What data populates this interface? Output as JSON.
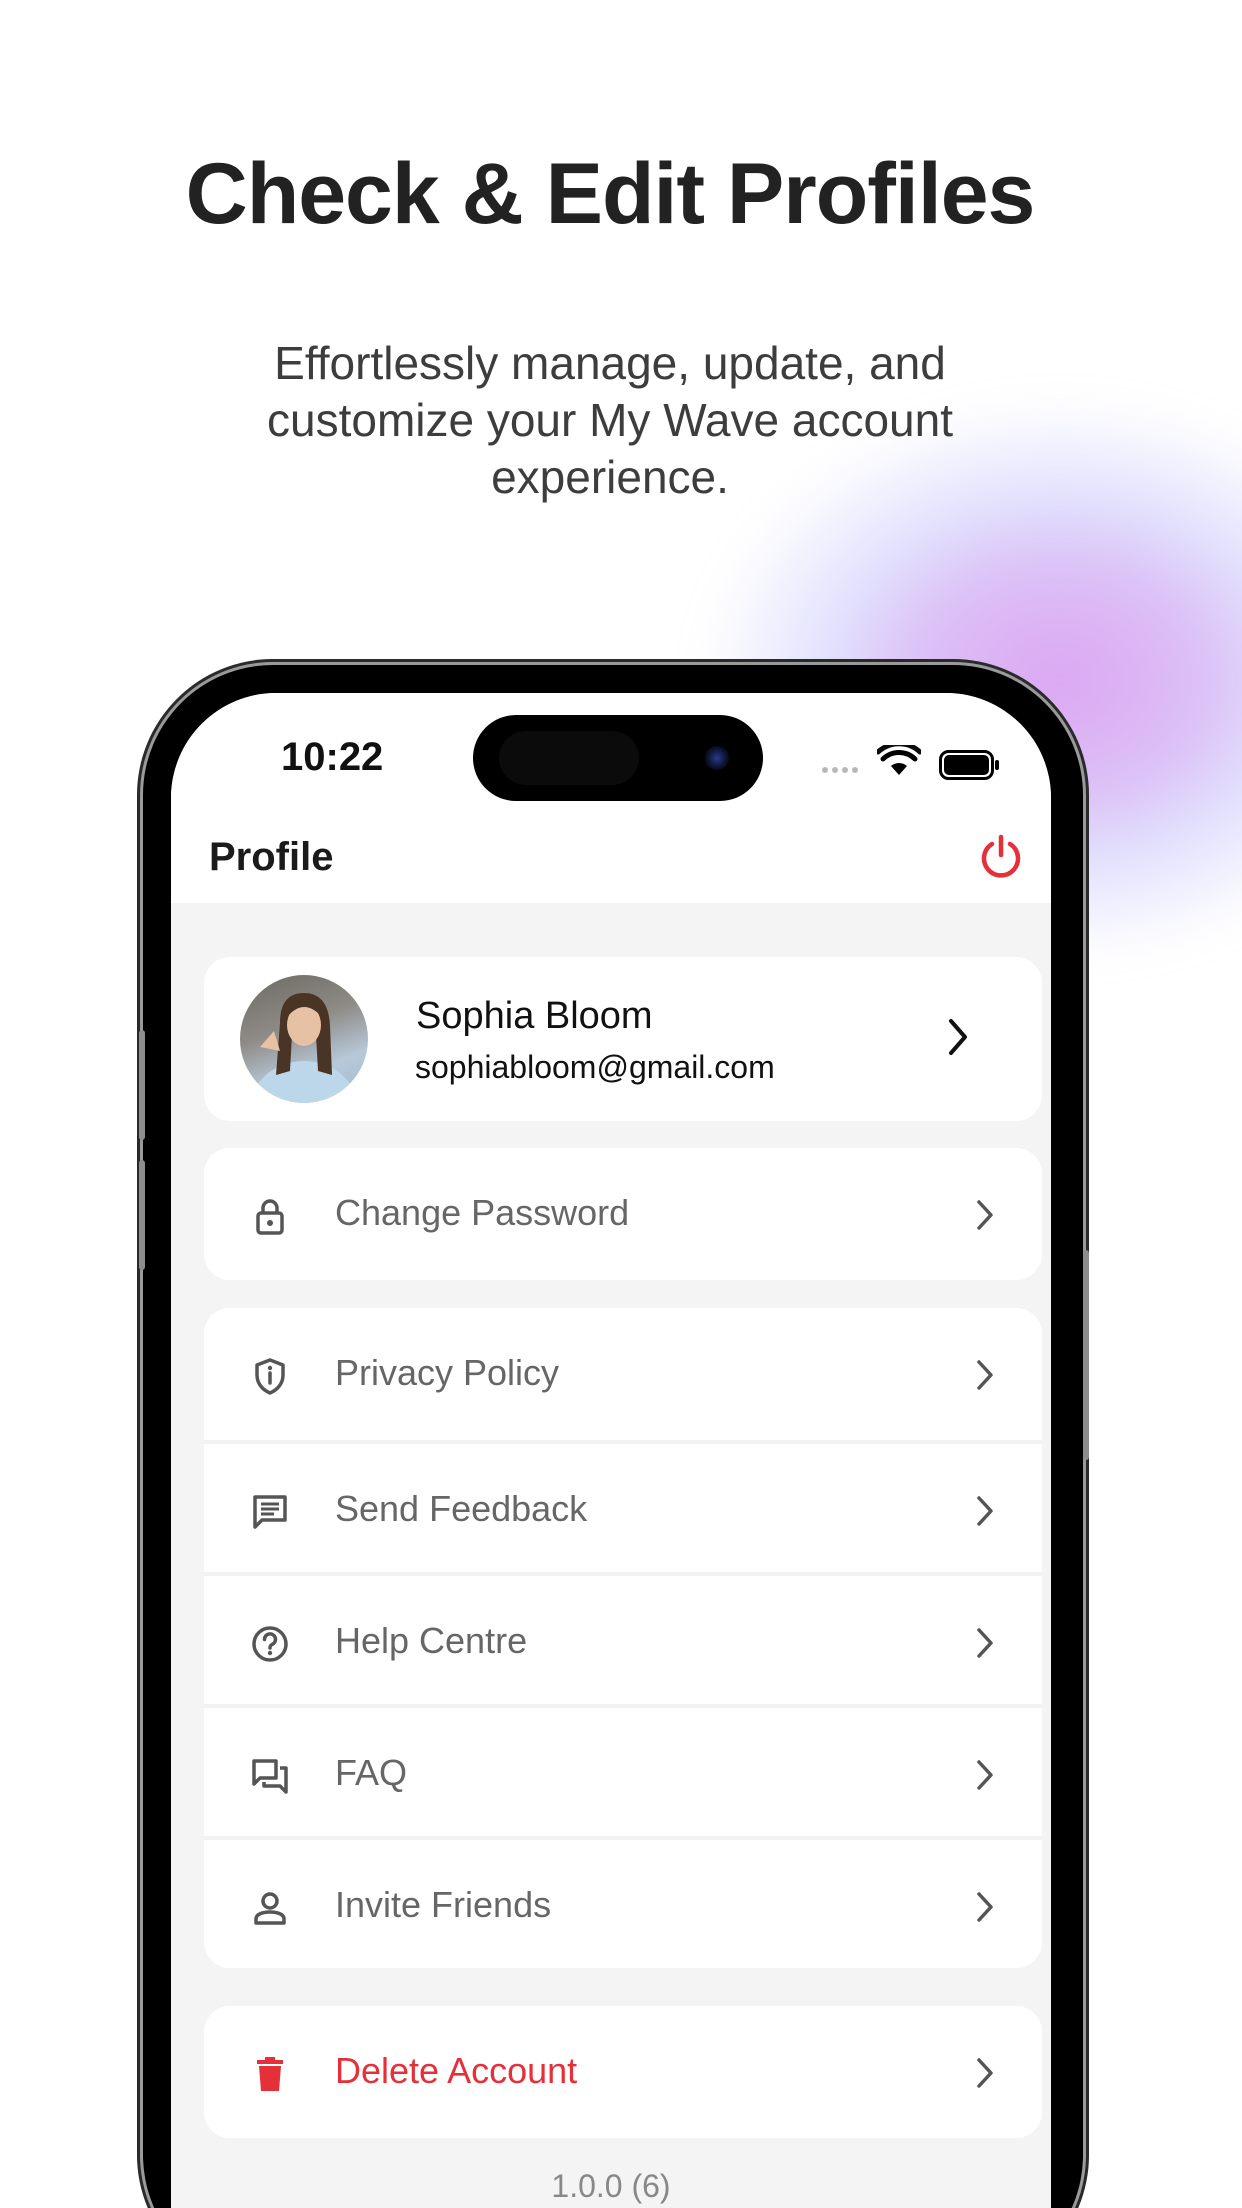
{
  "marketing": {
    "headline": "Check & Edit Profiles",
    "subline": "Effortlessly manage, update, and customize your My Wave account experience."
  },
  "status_bar": {
    "time": "10:22",
    "icons": [
      "cellular-signal-icon",
      "wifi-icon",
      "battery-icon"
    ]
  },
  "header": {
    "title": "Profile",
    "power_icon": "power-icon"
  },
  "profile": {
    "name": "Sophia Bloom",
    "email": "sophiabloom@gmail.com"
  },
  "menu_groups": [
    {
      "items": [
        {
          "label": "Change Password",
          "icon": "lock-icon"
        }
      ]
    },
    {
      "items": [
        {
          "label": "Privacy Policy",
          "icon": "shield-icon"
        },
        {
          "label": "Send Feedback",
          "icon": "message-icon"
        },
        {
          "label": "Help Centre",
          "icon": "help-circle-icon"
        },
        {
          "label": "FAQ",
          "icon": "chat-bubbles-icon"
        },
        {
          "label": "Invite Friends",
          "icon": "person-icon"
        }
      ]
    },
    {
      "items": [
        {
          "label": "Delete Account",
          "icon": "trash-icon"
        }
      ]
    }
  ],
  "version": "1.0.0 (6)",
  "colors": {
    "accent_red": "#e5303a",
    "background": "#f4f4f4",
    "card": "#ffffff",
    "text_primary": "#111111",
    "text_secondary": "#666666"
  }
}
